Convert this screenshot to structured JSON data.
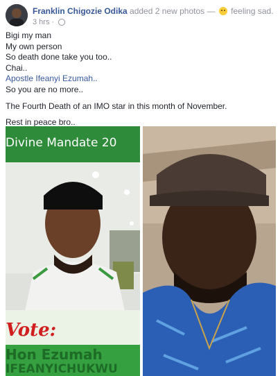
{
  "post": {
    "author": "Franklin Chigozie Odika",
    "action": "added 2 new photos",
    "separator": "—",
    "feeling": "feeling sad.",
    "time": "3 hrs",
    "time_separator": "·",
    "emoji_icon": "sad-face-emoji-icon",
    "privacy_icon": "globe-icon"
  },
  "message": {
    "lines": [
      "Bigi my man",
      "My own person",
      "So death done take you too..",
      "Chai..",
      "Apostle Ifeanyi Ezumah..",
      "So you are no more..",
      "The Fourth Death of an IMO star in this month of November.",
      "Rest in peace bro.."
    ],
    "mention_color": "#365899"
  },
  "photos": {
    "left": {
      "banner": "Divine Mandate 20",
      "vote": "Vote:",
      "name": "Hon Ezumah",
      "subname": "IFEANYICHUKWU"
    },
    "right": {}
  },
  "colors": {
    "link": "#365899",
    "meta": "#90949c",
    "text": "#1d2129"
  }
}
